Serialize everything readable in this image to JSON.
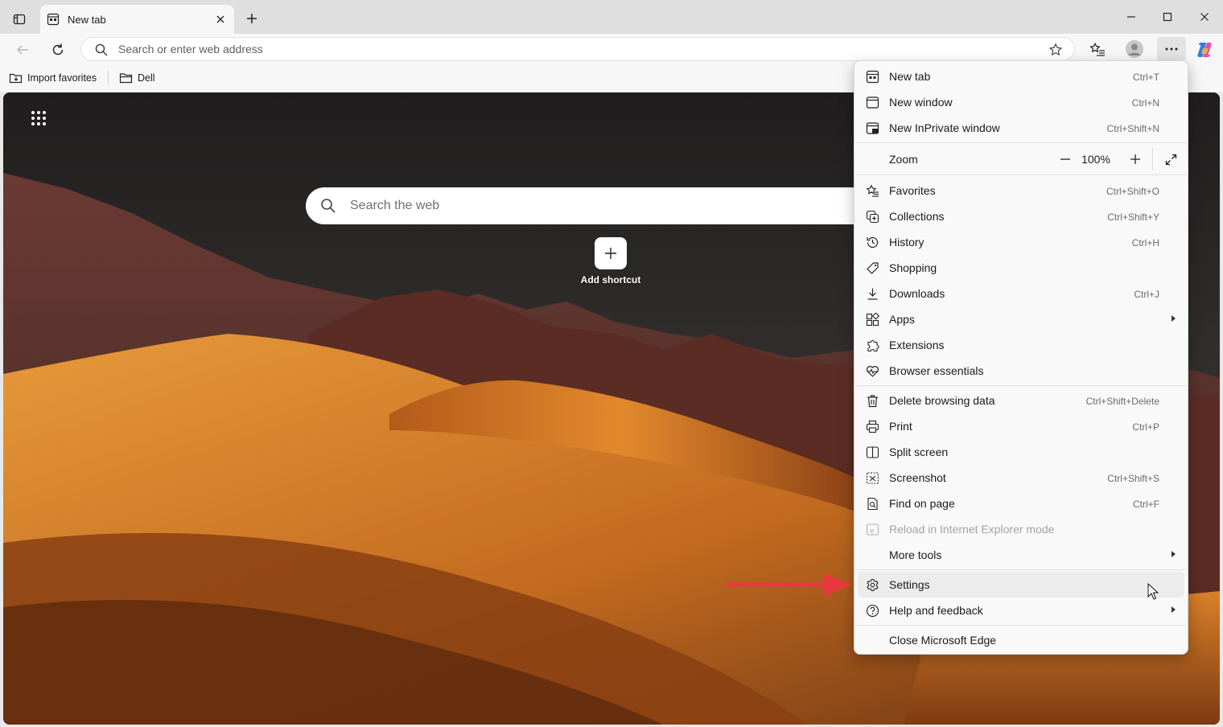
{
  "browser": {
    "tab_title": "New tab",
    "address_placeholder": "Search or enter web address"
  },
  "favorites_bar": {
    "items": [
      {
        "label": "Import favorites"
      },
      {
        "label": "Dell"
      }
    ]
  },
  "newtab_page": {
    "search_placeholder": "Search the web",
    "shortcut_label": "Add shortcut"
  },
  "menu": {
    "new_tab": {
      "label": "New tab",
      "shortcut": "Ctrl+T"
    },
    "new_window": {
      "label": "New window",
      "shortcut": "Ctrl+N"
    },
    "new_inprivate": {
      "label": "New InPrivate window",
      "shortcut": "Ctrl+Shift+N"
    },
    "zoom": {
      "label": "Zoom",
      "value": "100%"
    },
    "favorites": {
      "label": "Favorites",
      "shortcut": "Ctrl+Shift+O"
    },
    "collections": {
      "label": "Collections",
      "shortcut": "Ctrl+Shift+Y"
    },
    "history": {
      "label": "History",
      "shortcut": "Ctrl+H"
    },
    "shopping": {
      "label": "Shopping"
    },
    "downloads": {
      "label": "Downloads",
      "shortcut": "Ctrl+J"
    },
    "apps": {
      "label": "Apps"
    },
    "extensions": {
      "label": "Extensions"
    },
    "browser_essentials": {
      "label": "Browser essentials"
    },
    "delete_browsing_data": {
      "label": "Delete browsing data",
      "shortcut": "Ctrl+Shift+Delete"
    },
    "print": {
      "label": "Print",
      "shortcut": "Ctrl+P"
    },
    "split_screen": {
      "label": "Split screen"
    },
    "screenshot": {
      "label": "Screenshot",
      "shortcut": "Ctrl+Shift+S"
    },
    "find_on_page": {
      "label": "Find on page",
      "shortcut": "Ctrl+F"
    },
    "reload_ie": {
      "label": "Reload in Internet Explorer mode"
    },
    "more_tools": {
      "label": "More tools"
    },
    "settings": {
      "label": "Settings"
    },
    "help_feedback": {
      "label": "Help and feedback"
    },
    "close_edge": {
      "label": "Close Microsoft Edge"
    }
  },
  "colors": {
    "annotation_arrow": "#e8383d",
    "menu_background": "#f9f9f9",
    "chrome_background": "#f7f7f7"
  }
}
